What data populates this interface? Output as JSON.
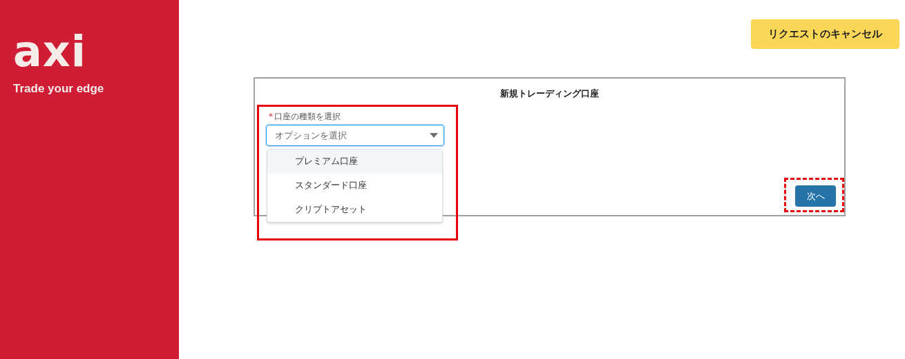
{
  "brand": {
    "logo": "axi",
    "tagline": "Trade your edge"
  },
  "cancel_button": "リクエストのキャンセル",
  "form": {
    "title": "新規トレーディング口座",
    "field": {
      "required_mark": "*",
      "label": "口座の種類を選択",
      "placeholder": "オプションを選択",
      "expanded": true,
      "options": [
        {
          "label": "プレミアム口座",
          "selected": true
        },
        {
          "label": "スタンダード口座",
          "selected": false
        },
        {
          "label": "クリプトアセット",
          "selected": false
        }
      ]
    },
    "next_button": "次へ"
  },
  "highlights": [
    {
      "kind": "solid"
    },
    {
      "kind": "dashed"
    }
  ]
}
